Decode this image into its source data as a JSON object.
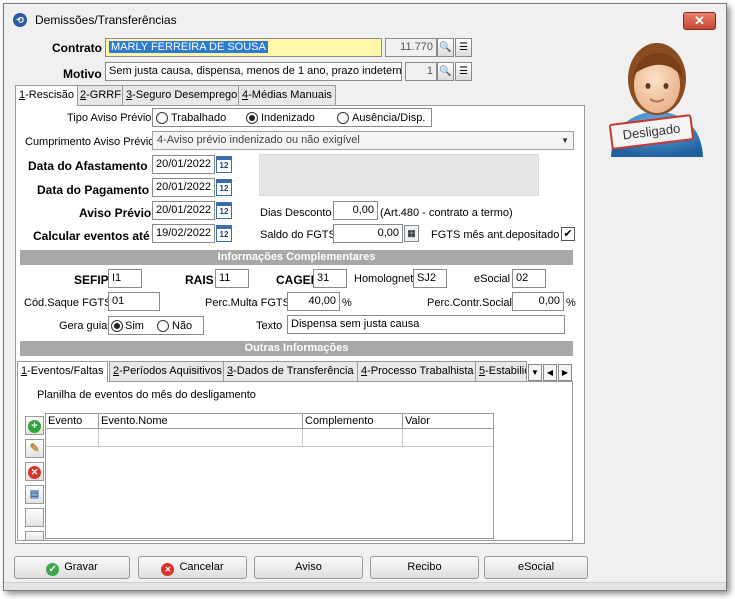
{
  "window": {
    "title": "Demissões/Transferências",
    "close_label": "✕"
  },
  "header": {
    "contrato_label": "Contrato",
    "contrato_value": "MARLY FERREIRA DE SOUSA",
    "contrato_code": "11.770",
    "motivo_label": "Motivo",
    "motivo_value": "Sem justa causa, dispensa, menos de 1 ano, prazo indetermi",
    "motivo_code": "1",
    "badge": "Desligado"
  },
  "tabs": [
    {
      "key": "1",
      "label": "-Rescisão"
    },
    {
      "key": "2",
      "label": "-GRRF"
    },
    {
      "key": "3",
      "label": "-Seguro Desemprego"
    },
    {
      "key": "4",
      "label": "-Médias Manuais"
    }
  ],
  "rescisao": {
    "tipo_aviso_label": "Tipo Aviso Prévio",
    "tipo_options": [
      "Trabalhado",
      "Indenizado",
      "Ausência/Disp."
    ],
    "tipo_selected": "Indenizado",
    "cumprimento_label": "Cumprimento Aviso Prévio",
    "cumprimento_value": "4-Aviso prévio indenizado ou não exigível",
    "data_afastamento_label": "Data do Afastamento",
    "data_afastamento": "20/01/2022",
    "data_pagamento_label": "Data do Pagamento",
    "data_pagamento": "20/01/2022",
    "aviso_previo_label": "Aviso Prévio",
    "aviso_previo": "20/01/2022",
    "calcular_label": "Calcular eventos até",
    "calcular": "19/02/2022",
    "dias_desconto_label": "Dias Desconto",
    "dias_desconto": "0,00",
    "art480_label": "(Art.480 - contrato a termo)",
    "saldo_fgts_label": "Saldo do FGTS",
    "saldo_fgts": "0,00",
    "fgts_mes_label": "FGTS mês ant.depositado",
    "fgts_mes_checked": true,
    "calendar_glyph": "12"
  },
  "complementares": {
    "title": "Informações Complementares",
    "sefip_label": "SEFIP",
    "sefip": "I1",
    "rais_label": "RAIS",
    "rais": "11",
    "caged_label": "CAGED",
    "caged": "31",
    "homolognet_label": "Homolognet",
    "homolognet": "SJ2",
    "esocial_label": "eSocial",
    "esocial": "02",
    "cod_saque_label": "Cód.Saque FGTS",
    "cod_saque": "01",
    "perc_multa_label": "Perc.Multa FGTS",
    "perc_multa": "40,00",
    "perc_contr_label": "Perc.Contr.Social",
    "perc_contr": "0,00",
    "percent_sign": "%",
    "gera_guia_label": "Gera guia",
    "gera_guia_options": [
      "Sim",
      "Não"
    ],
    "gera_guia_selected": "Sim",
    "texto_label": "Texto",
    "texto": "Dispensa sem justa causa"
  },
  "outras": {
    "title": "Outras Informações",
    "tabs": [
      {
        "key": "1",
        "label": "-Eventos/Faltas"
      },
      {
        "key": "2",
        "label": "-Períodos Aquisitivos"
      },
      {
        "key": "3",
        "label": "-Dados de Transferência"
      },
      {
        "key": "4",
        "label": "-Processo Trabalhista"
      },
      {
        "key": "5",
        "label": "-Estabilid"
      }
    ],
    "planilha_label": "Planilha de eventos do mês do desligamento",
    "columns": [
      "Evento",
      "Evento.Nome",
      "Complemento",
      "Valor"
    ]
  },
  "buttons": {
    "gravar": "Gravar",
    "cancelar": "Cancelar",
    "aviso": "Aviso",
    "recibo": "Recibo",
    "esocial": "eSocial"
  }
}
